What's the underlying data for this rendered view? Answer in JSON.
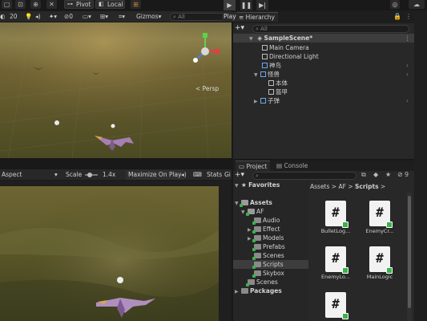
{
  "toolbar": {
    "pivot_label": "Pivot",
    "local_label": "Local",
    "play_label": "Play"
  },
  "scene": {
    "toolbar": {
      "zoom_value": "20",
      "gizmos_label": "Gizmos",
      "search_placeholder": "All"
    },
    "persp_label": "< Persp"
  },
  "game": {
    "toolbar": {
      "aspect_label": "Aspect",
      "scale_label": "Scale",
      "scale_value": "1.4x",
      "maximize_label": "Maximize On Play",
      "stats_label": "Stats",
      "gizmos_short": "Gi"
    }
  },
  "hierarchy": {
    "tab_label": "Hierarchy",
    "search_placeholder": "All",
    "items": [
      {
        "label": "SampleScene*"
      },
      {
        "label": "Main Camera"
      },
      {
        "label": "Directional Light"
      },
      {
        "label": "神鸟"
      },
      {
        "label": "怪兽"
      },
      {
        "label": "本体"
      },
      {
        "label": "盔甲"
      },
      {
        "label": "子弹"
      }
    ]
  },
  "project": {
    "tab_project": "Project",
    "tab_console": "Console",
    "visible_count": "9",
    "favorites_label": "Favorites",
    "tree": [
      {
        "label": "Assets"
      },
      {
        "label": "AF"
      },
      {
        "label": "Audio"
      },
      {
        "label": "Effect"
      },
      {
        "label": "Models"
      },
      {
        "label": "Prefabs"
      },
      {
        "label": "Scenes"
      },
      {
        "label": "Scripts"
      },
      {
        "label": "Skybox"
      },
      {
        "label": "Scenes"
      },
      {
        "label": "Packages"
      }
    ],
    "breadcrumb": [
      "Assets",
      "AF",
      "Scripts"
    ],
    "files": [
      {
        "label": "BulletLog..."
      },
      {
        "label": "EnemyCr..."
      },
      {
        "label": "EnemyLo..."
      },
      {
        "label": "MainLogic"
      },
      {
        "label": ""
      }
    ]
  },
  "colors": {
    "selection": "#3d3d3d",
    "script_badge": "#3bb34a",
    "prefab_blue": "#6aa8e8",
    "panel_bg": "#282828"
  }
}
